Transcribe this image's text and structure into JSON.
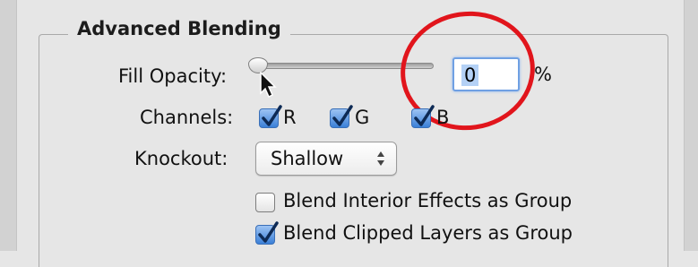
{
  "panel": {
    "title": "Advanced Blending"
  },
  "fill_opacity": {
    "label": "Fill Opacity:",
    "value": "0",
    "unit": "%",
    "slider_fraction": 0.0
  },
  "channels": {
    "label": "Channels:",
    "items": [
      {
        "label": "R",
        "checked": true
      },
      {
        "label": "G",
        "checked": true
      },
      {
        "label": "B",
        "checked": true
      }
    ]
  },
  "knockout": {
    "label": "Knockout:",
    "selected": "Shallow"
  },
  "options": [
    {
      "label": "Blend Interior Effects as Group",
      "checked": false
    },
    {
      "label": "Blend Clipped Layers as Group",
      "checked": true
    }
  ],
  "colors": {
    "accent": "#3b80d8",
    "highlight_circle": "#e1151c",
    "background": "#e6e6e6"
  }
}
